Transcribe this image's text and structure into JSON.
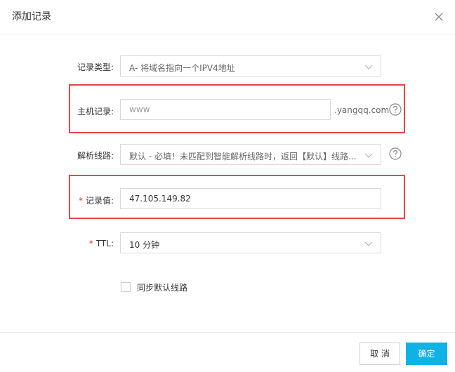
{
  "dialog": {
    "title": "添加记录",
    "close_icon": "close-icon"
  },
  "form": {
    "record_type": {
      "label": "记录类型:",
      "value": "A- 将域名指向一个IPV4地址"
    },
    "host": {
      "label": "主机记录:",
      "value": "www",
      "suffix": ".yangqq.com"
    },
    "line": {
      "label": "解析线路:",
      "value": "默认 - 必填！未匹配到智能解析线路时，返回【默认】线路..."
    },
    "record_value": {
      "required_mark": "*",
      "label": "记录值:",
      "value": "47.105.149.82"
    },
    "ttl": {
      "required_mark": "*",
      "label": "TTL:",
      "value": "10 分钟"
    },
    "sync": {
      "label": "同步默认线路",
      "checked": false
    }
  },
  "footer": {
    "cancel_label": "取 消",
    "ok_label": "确定"
  },
  "colors": {
    "accent": "#10b2e6",
    "highlight_border": "#e64545",
    "required": "#e03c3c"
  }
}
